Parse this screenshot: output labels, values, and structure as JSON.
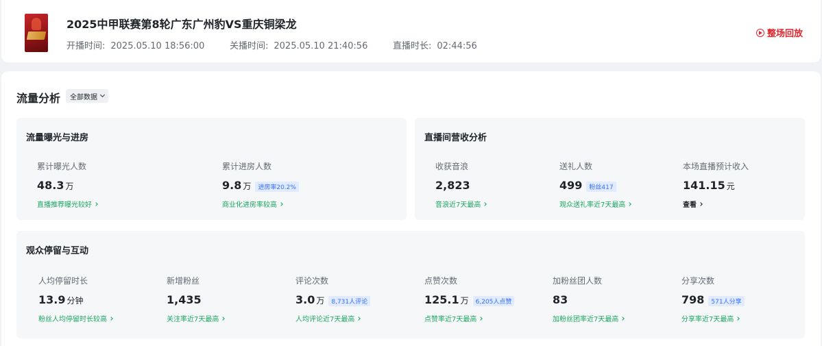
{
  "header": {
    "title": "2025中甲联赛第8轮广东广州豹VS重庆铜梁龙",
    "start_label": "开播时间:",
    "start_value": "2025.05.10 18:56:00",
    "end_label": "关播时间:",
    "end_value": "2025.05.10 21:40:56",
    "duration_label": "直播时长:",
    "duration_value": "02:44:56",
    "replay_label": "整场回放"
  },
  "analysis": {
    "title": "流量分析",
    "filter_label": "全部数据"
  },
  "exposure": {
    "title": "流量曝光与进房",
    "metrics": [
      {
        "label": "累计曝光人数",
        "value": "48.3",
        "unit": "万",
        "badge": "",
        "link": "直播推荐曝光较好"
      },
      {
        "label": "累计进房人数",
        "value": "9.8",
        "unit": "万",
        "badge": "进房率20.2%",
        "link": "商业化进房率较高"
      }
    ]
  },
  "revenue": {
    "title": "直播间营收分析",
    "metrics": [
      {
        "label": "收获音浪",
        "value": "2,823",
        "unit": "",
        "badge": "",
        "link": "音浪近7天最高"
      },
      {
        "label": "送礼人数",
        "value": "499",
        "unit": "",
        "badge": "粉丝417",
        "link": "观众送礼率近7天最高"
      },
      {
        "label": "本场直播预计收入",
        "value": "141.15",
        "unit": "元",
        "badge": "",
        "link": "查看"
      }
    ]
  },
  "engagement": {
    "title": "观众停留与互动",
    "metrics": [
      {
        "label": "人均停留时长",
        "value": "13.9",
        "unit": "分钟",
        "badge": "",
        "link": "粉丝人均停留时长较高"
      },
      {
        "label": "新增粉丝",
        "value": "1,435",
        "unit": "",
        "badge": "",
        "link": "关注率近7天最高"
      },
      {
        "label": "评论次数",
        "value": "3.0",
        "unit": "万",
        "badge": "8,731人评论",
        "link": "人均评论近7天最高"
      },
      {
        "label": "点赞次数",
        "value": "125.1",
        "unit": "万",
        "badge": "6,205人点赞",
        "link": "点赞率近7天最高"
      },
      {
        "label": "加粉丝团人数",
        "value": "83",
        "unit": "",
        "badge": "",
        "link": "加粉丝团率近7天最高"
      },
      {
        "label": "分享次数",
        "value": "798",
        "unit": "",
        "badge": "571人分享",
        "link": "分享率近7天最高"
      }
    ]
  },
  "colors": {
    "accent_red": "#e0252b",
    "link_green": "#1aa760",
    "badge_blue": "#3370ff"
  }
}
